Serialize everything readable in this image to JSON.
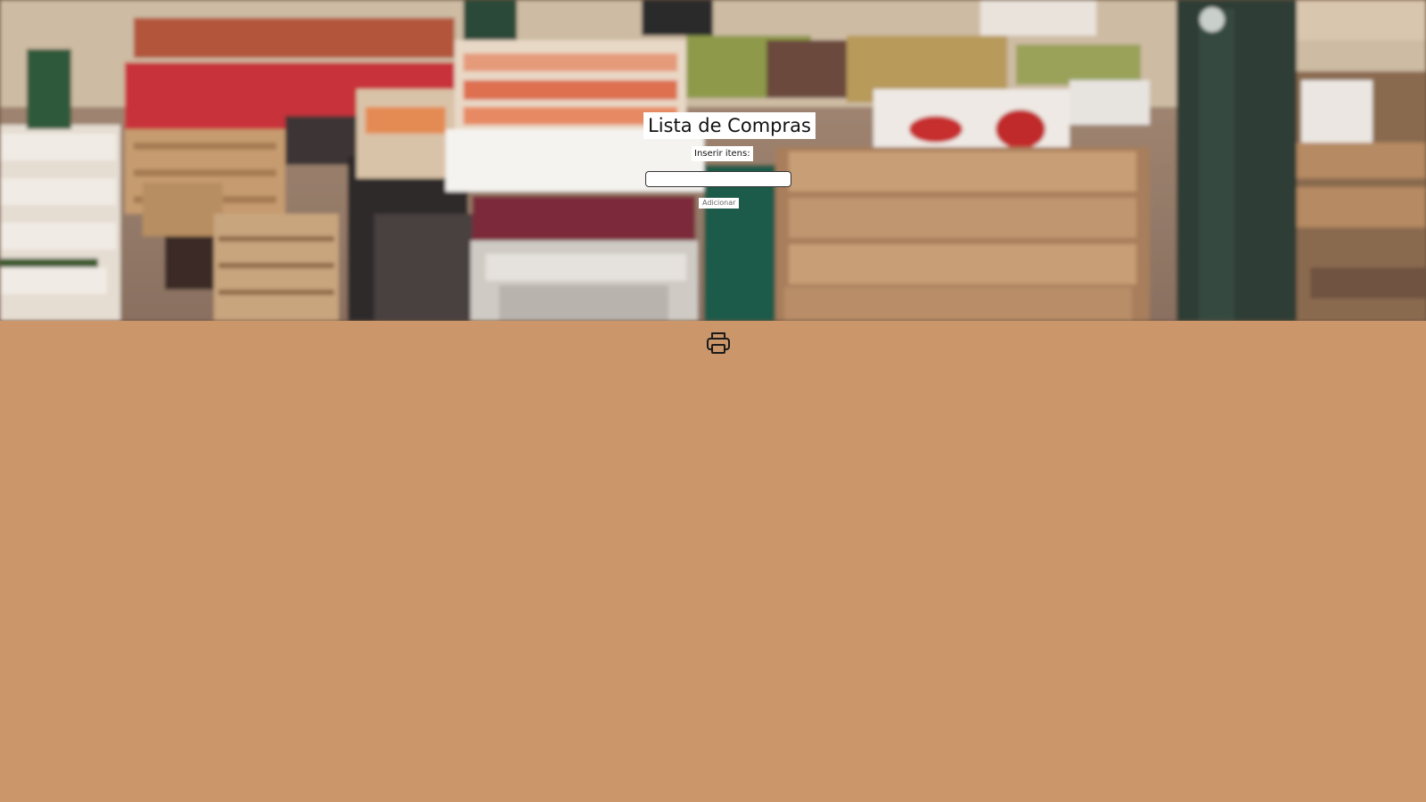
{
  "page": {
    "title": "Lista de Compras",
    "input_label": "Inserir itens:",
    "input_value": "",
    "add_button_label": "Adicionar",
    "print_icon": "printer-icon"
  },
  "colors": {
    "page_background": "#cb976a",
    "label_background": "#ffffff",
    "text": "#111111"
  },
  "hero": {
    "image": "market-stall-background"
  }
}
